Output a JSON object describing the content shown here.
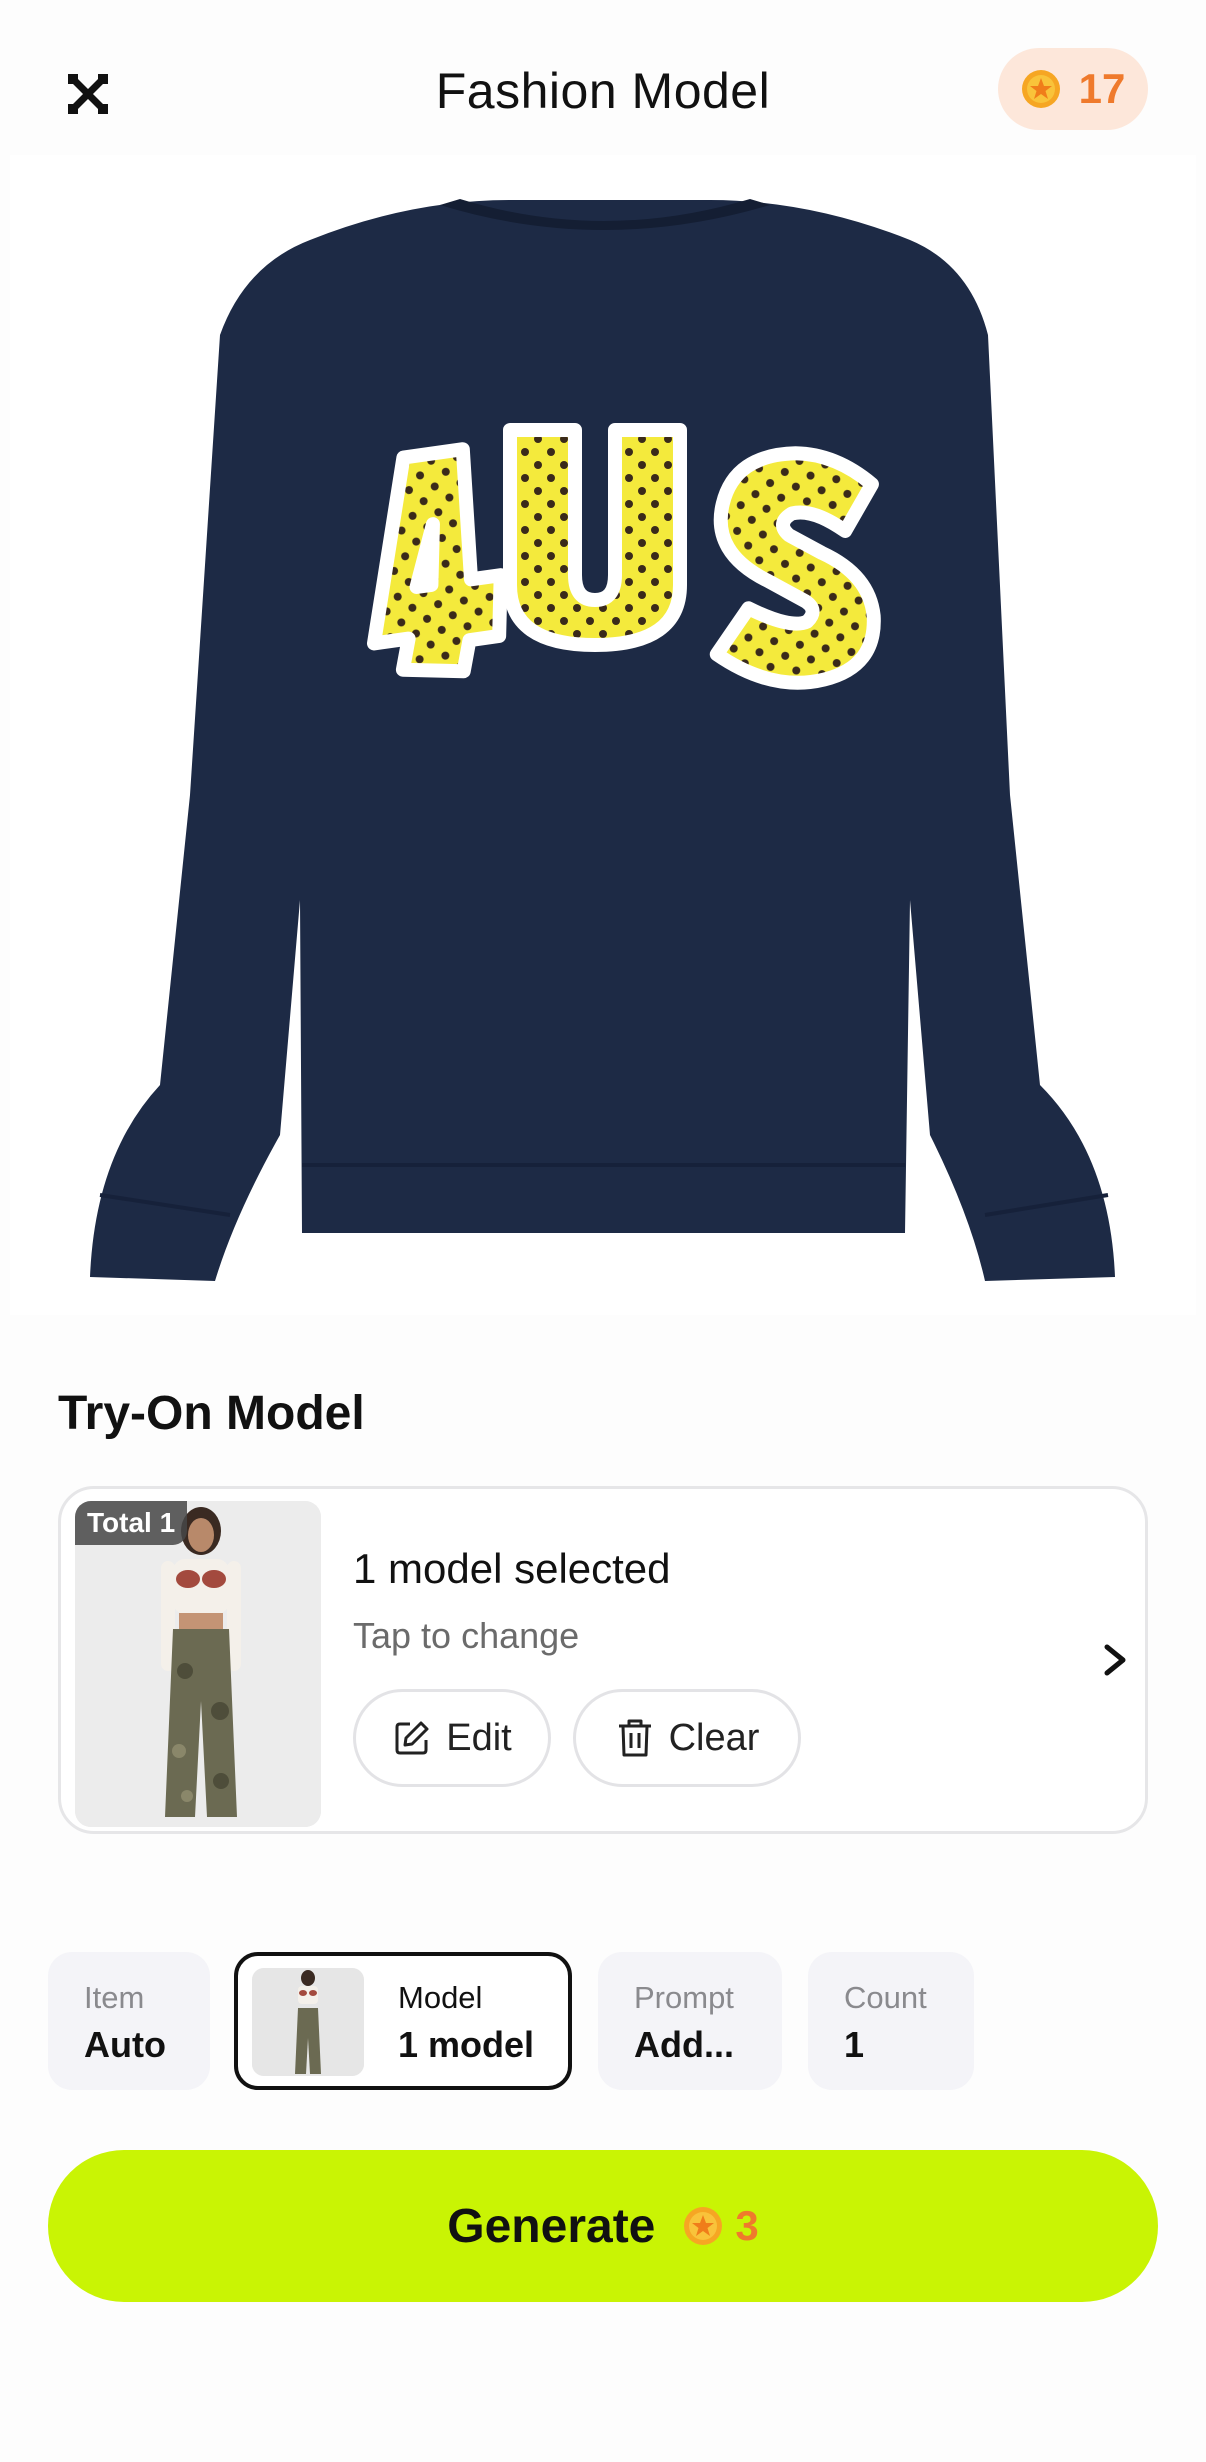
{
  "header": {
    "title": "Fashion Model",
    "coins": "17",
    "close_icon": "close-x-icon",
    "coin_icon": "coin-icon"
  },
  "product": {
    "print_text": "4US"
  },
  "try_on": {
    "section_title": "Try-On Model",
    "total_tag": "Total 1",
    "summary": "1 model selected",
    "hint": "Tap to change",
    "edit_label": "Edit",
    "clear_label": "Clear"
  },
  "options": {
    "item": {
      "label": "Item",
      "value": "Auto"
    },
    "model": {
      "label": "Model",
      "value": "1 model"
    },
    "prompt": {
      "label": "Prompt",
      "value": "Add..."
    },
    "count": {
      "label": "Count",
      "value": "1"
    }
  },
  "generate": {
    "label": "Generate",
    "cost": "3"
  },
  "colors": {
    "accent": "#c9f404",
    "coin": "#ef7a2c",
    "coin_badge_bg": "#fde7da",
    "sweater": "#1d2a45",
    "letters": "#f4ea3c"
  }
}
